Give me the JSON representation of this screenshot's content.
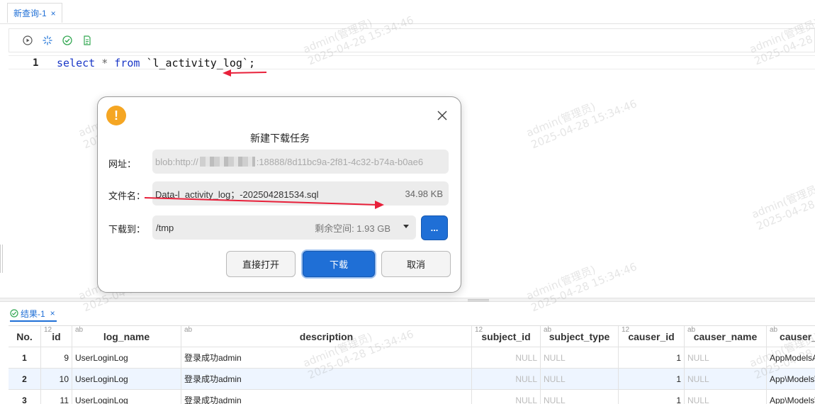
{
  "tab": {
    "label": "新查询-1",
    "close": "×"
  },
  "editor": {
    "line_number": "1",
    "sql_select": "select",
    "sql_star": "*",
    "sql_from": "from",
    "sql_table": "`l_activity_log`",
    "sql_semicolon": ";"
  },
  "dialog": {
    "title": "新建下载任务",
    "url_label": "网址：",
    "url_prefix": "blob:http://",
    "url_suffix": ":18888/8d11bc9a-2f81-4c32-b74a-b0ae6",
    "filename_label": "文件名：",
    "filename": "Data-l_activity_log；-202504281534.sql",
    "filesize": "34.98 KB",
    "dest_label": "下载到：",
    "dest_path": "/tmp",
    "free_space": "剩余空间: 1.93 GB",
    "browse_label": "...",
    "open_label": "直接打开",
    "download_label": "下载",
    "cancel_label": "取消"
  },
  "result_tab": {
    "label": "结果-1",
    "close": "×"
  },
  "grid": {
    "columns": [
      {
        "label": "No.",
        "type": ""
      },
      {
        "label": "id",
        "type": "12"
      },
      {
        "label": "log_name",
        "type": "ab"
      },
      {
        "label": "description",
        "type": "ab"
      },
      {
        "label": "subject_id",
        "type": "12"
      },
      {
        "label": "subject_type",
        "type": "ab"
      },
      {
        "label": "causer_id",
        "type": "12"
      },
      {
        "label": "causer_name",
        "type": "ab"
      },
      {
        "label": "causer_",
        "type": "ab"
      }
    ],
    "rows": [
      [
        "1",
        "9",
        "UserLoginLog",
        "登录成功admin",
        "NULL",
        "NULL",
        "1",
        "NULL",
        "AppModelsA"
      ],
      [
        "2",
        "10",
        "UserLoginLog",
        "登录成功admin",
        "NULL",
        "NULL",
        "1",
        "NULL",
        "App\\Models\\"
      ],
      [
        "3",
        "11",
        "UserLoginLog",
        "登录成功admin",
        "NULL",
        "NULL",
        "1",
        "NULL",
        "App\\Models\\"
      ]
    ]
  },
  "watermark": {
    "user": "admin(管理员)",
    "time": "2025-04-28 15:34:46"
  },
  "colors": {
    "accent": "#1f6fd6",
    "warning": "#f5a623",
    "annotation": "#e8203a"
  },
  "icons": [
    "run-icon",
    "format-icon",
    "check-icon",
    "explain-icon",
    "warning-icon",
    "close-icon"
  ]
}
